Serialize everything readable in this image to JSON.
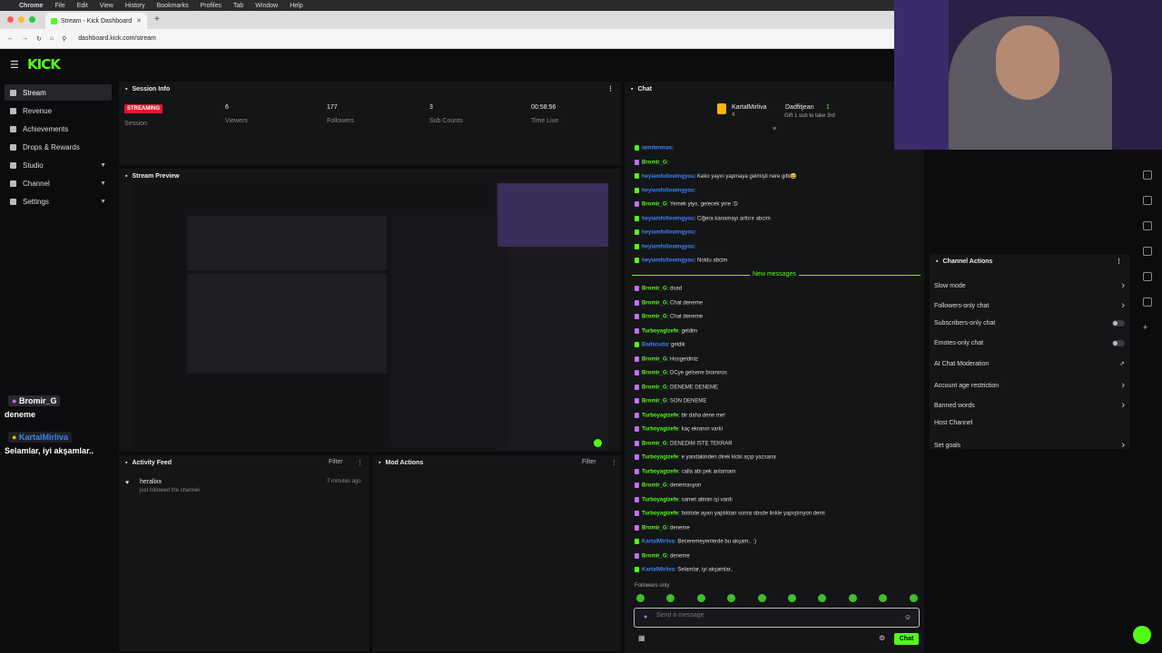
{
  "macbar": {
    "apple": "",
    "app": "Chrome",
    "menus": [
      "File",
      "Edit",
      "View",
      "History",
      "Bookmarks",
      "Profiles",
      "Tab",
      "Window",
      "Help"
    ]
  },
  "browser": {
    "tab_title": "Stream - Kick Dashboard",
    "url": "dashboard.kick.com/stream"
  },
  "sidebar": {
    "items": [
      {
        "label": "Stream",
        "active": true
      },
      {
        "label": "Revenue"
      },
      {
        "label": "Achievements"
      },
      {
        "label": "Drops & Rewards"
      },
      {
        "label": "Studio",
        "chevron": true
      },
      {
        "label": "Channel",
        "chevron": true
      },
      {
        "label": "Settings",
        "chevron": true
      }
    ]
  },
  "session": {
    "title": "Session Info",
    "status": "STREAMING",
    "status_label": "Session",
    "stats": [
      {
        "value": "6",
        "label": "Viewers"
      },
      {
        "value": "177",
        "label": "Followers"
      },
      {
        "value": "3",
        "label": "Sub Counts"
      },
      {
        "value": "00:58:56",
        "label": "Time Live"
      }
    ]
  },
  "preview": {
    "title": "Stream Preview"
  },
  "overlay": {
    "user1": "Bromir_G",
    "msg1": "deneme",
    "user2": "KartalMirliva",
    "msg2": "Selamlar, iyi akşamlar.."
  },
  "activity": {
    "title": "Activity Feed",
    "filter": "Filter",
    "entry_user": "heralixx",
    "entry_text": "just followed the channel",
    "entry_time": "7 minutes ago"
  },
  "mod": {
    "title": "Mod Actions",
    "filter": "Filter"
  },
  "chat": {
    "title": "Chat",
    "pinned_user": "KartalMirliva",
    "pinned_count": "4",
    "gifter": "Dadfitjean",
    "gifter_count": "1",
    "gift_text": "Gift 1 sub to take 3rd",
    "messages_old": [
      {
        "u": "iamdenmas",
        "t": "",
        "c": "#3b82f6"
      },
      {
        "u": "Bromir_G",
        "t": "",
        "c": "#53fc18"
      },
      {
        "u": "heyiamfollowingyou",
        "t": "Keko yayın yapmaya gelmişti nere gitti😆",
        "c": "#3b82f6"
      },
      {
        "u": "heyiamfollowingyou",
        "t": "",
        "c": "#3b82f6"
      },
      {
        "u": "Bromir_G",
        "t": "Yemek yiyo, gelecek yine :D",
        "c": "#53fc18"
      },
      {
        "u": "heyiamfollowingyou",
        "t": "Ciğera kanamayı arttırır abcim",
        "c": "#3b82f6"
      },
      {
        "u": "heyiamfollowingyou",
        "t": "",
        "c": "#3b82f6"
      },
      {
        "u": "heyiamfollowingyou",
        "t": "",
        "c": "#3b82f6"
      },
      {
        "u": "heyiamfollowingyou",
        "t": "Noldu abcim",
        "c": "#3b82f6"
      }
    ],
    "new_messages_label": "New messages",
    "messages_new": [
      {
        "u": "Bromir_G",
        "t": "dsad",
        "c": "#53fc18"
      },
      {
        "u": "Bromir_G",
        "t": "Chat deneme",
        "c": "#53fc18"
      },
      {
        "u": "Bromir_G",
        "t": "Chat deneme",
        "c": "#53fc18"
      },
      {
        "u": "Turboyagizefe",
        "t": "geldim",
        "c": "#53fc18"
      },
      {
        "u": "Badacuda",
        "t": "geldik",
        "c": "#3b82f6"
      },
      {
        "u": "Bromir_G",
        "t": "Hosgeldiniz",
        "c": "#53fc18"
      },
      {
        "u": "Bromir_G",
        "t": "DCye gelsene bromiros",
        "c": "#53fc18"
      },
      {
        "u": "Bromir_G",
        "t": "DENEME DENEME",
        "c": "#53fc18"
      },
      {
        "u": "Bromir_G",
        "t": "SON DENEME",
        "c": "#53fc18"
      },
      {
        "u": "Turboyagizefe",
        "t": "bir daha dene me!",
        "c": "#53fc18"
      },
      {
        "u": "Turboyagizefe",
        "t": "kaç ekranın varki",
        "c": "#53fc18"
      },
      {
        "u": "Bromir_G",
        "t": "DENEDIM ISTE TEKRAR",
        "c": "#53fc18"
      },
      {
        "u": "Turboyagizefe",
        "t": "e yandakinden direk kicki açıp yazsana",
        "c": "#53fc18"
      },
      {
        "u": "Turboyagizefe",
        "t": "calla abi pek anlamam",
        "c": "#53fc18"
      },
      {
        "u": "Bromir_G",
        "t": "denemasyon",
        "c": "#53fc18"
      },
      {
        "u": "Turboyagizefe",
        "t": "samet abinin işi vardı",
        "c": "#53fc18"
      },
      {
        "u": "Turboyagizefe",
        "t": "botrixte ayarı yaptıktan sonra obsde linkle yapıştırıyon demi",
        "c": "#53fc18"
      },
      {
        "u": "Bromir_G",
        "t": "deneme",
        "c": "#53fc18"
      },
      {
        "u": "KartalMirliva",
        "t": "Beceremeyenlerde bu akşam.. :)",
        "c": "#3b82f6"
      },
      {
        "u": "Bromir_G",
        "t": "deneme",
        "c": "#53fc18"
      },
      {
        "u": "KartalMirliva",
        "t": "Selamlar, iyi akşamlar..",
        "c": "#3b82f6"
      }
    ],
    "followers_only": "Followers only",
    "placeholder": "Send a message",
    "send_label": "Chat"
  },
  "actions": {
    "title": "Channel Actions",
    "items": [
      {
        "label": "Slow mode",
        "ctl": "chev"
      },
      {
        "label": "Followers-only chat",
        "ctl": "chev"
      },
      {
        "label": "Subscribers-only chat",
        "ctl": "toggle"
      },
      {
        "label": "Emotes-only chat",
        "ctl": "toggle"
      },
      {
        "label": "AI Chat Moderation",
        "ctl": "ext"
      },
      {
        "label": "Account age restriction",
        "ctl": "chev"
      },
      {
        "label": "Banned words",
        "ctl": "chev"
      },
      {
        "label": "Host Channel",
        "ctl": "none"
      },
      {
        "label": "Set goals",
        "ctl": "chev"
      }
    ]
  },
  "colors": {
    "brand": "#53fc18",
    "live": "#e0192f",
    "panel": "#141517",
    "bg": "#0b0c0e"
  }
}
